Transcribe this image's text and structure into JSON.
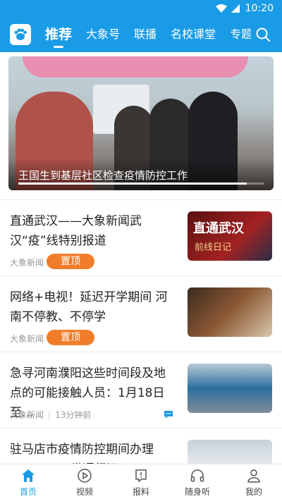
{
  "status": {
    "time": "10:20"
  },
  "colors": {
    "primary": "#1a9be5",
    "pin": "#f07d2a"
  },
  "header": {
    "tabs": [
      {
        "label": "推荐",
        "active": true
      },
      {
        "label": "大象号"
      },
      {
        "label": "联播"
      },
      {
        "label": "名校课堂"
      },
      {
        "label": "专题"
      }
    ]
  },
  "banner": {
    "caption": "王国生到基层社区检查疫情防控工作",
    "progress": 0.93
  },
  "news": [
    {
      "title": "直通武汉——大象新闻武汉“疫”线特别报道",
      "source": "大象新闻",
      "pin": "置顶",
      "thumb_title": "直通武汉",
      "thumb_sub": "前线日记"
    },
    {
      "title": "网络+电视！延迟开学期间 河南不停教、不停学",
      "source": "大象新闻",
      "pin": "置顶"
    },
    {
      "title": "急寻河南濮阳这些时间段及地点的可能接触人员：1月18日至…",
      "source": "大象新闻",
      "time": "13分钟前"
    },
    {
      "title": "驻马店市疫情防控期间办理A、B、C三类通行证"
    }
  ],
  "bottom_nav": [
    {
      "label": "首页",
      "icon": "home-icon",
      "active": true
    },
    {
      "label": "视频",
      "icon": "video-icon"
    },
    {
      "label": "报料",
      "icon": "report-icon"
    },
    {
      "label": "随身听",
      "icon": "headphones-icon"
    },
    {
      "label": "我的",
      "icon": "profile-icon"
    }
  ]
}
